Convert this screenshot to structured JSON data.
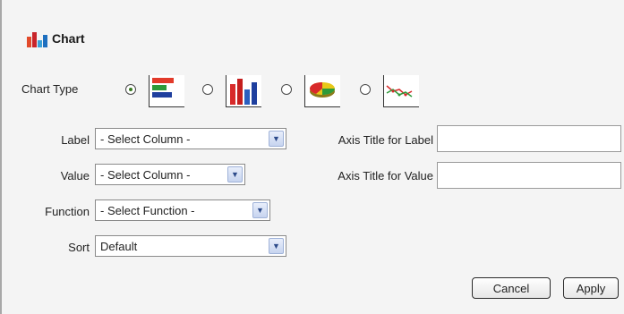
{
  "section": {
    "title": "Chart"
  },
  "chart_type": {
    "label": "Chart Type",
    "options": [
      {
        "icon": "horizontal-bar-chart-icon",
        "selected": true
      },
      {
        "icon": "vertical-bar-chart-icon",
        "selected": false
      },
      {
        "icon": "pie-chart-icon",
        "selected": false
      },
      {
        "icon": "line-chart-icon",
        "selected": false
      }
    ]
  },
  "fields": {
    "label": {
      "label": "Label",
      "value": "- Select Column -"
    },
    "value": {
      "label": "Value",
      "value": "- Select Column -"
    },
    "function": {
      "label": "Function",
      "value": "- Select Function -"
    },
    "sort": {
      "label": "Sort",
      "value": "Default"
    },
    "axis_title_label": {
      "label": "Axis Title for Label",
      "value": ""
    },
    "axis_title_value": {
      "label": "Axis Title for Value",
      "value": ""
    }
  },
  "buttons": {
    "cancel": "Cancel",
    "apply": "Apply"
  }
}
